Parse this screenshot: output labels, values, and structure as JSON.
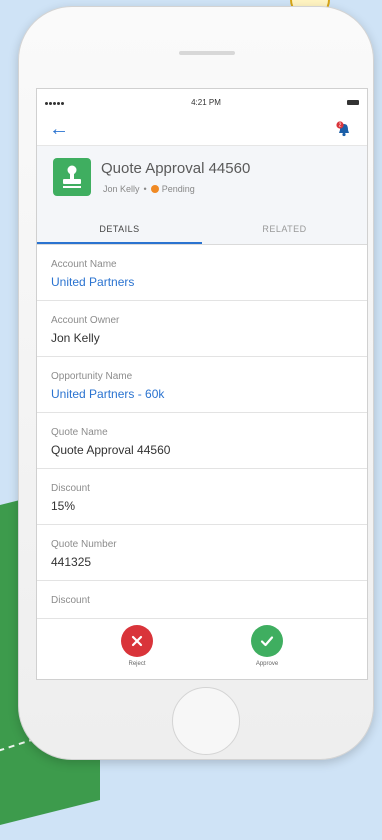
{
  "status_bar": {
    "time": "4:21 PM"
  },
  "record": {
    "title": "Quote Approval 44560",
    "owner": "Jon Kelly",
    "separator": "•",
    "status": "Pending"
  },
  "tabs": [
    {
      "label": "DETAILS",
      "active": true
    },
    {
      "label": "RELATED",
      "active": false
    }
  ],
  "fields": [
    {
      "label": "Account Name",
      "value": "United Partners",
      "link": true
    },
    {
      "label": "Account Owner",
      "value": "Jon Kelly",
      "link": false
    },
    {
      "label": "Opportunity Name",
      "value": "United Partners - 60k",
      "link": true
    },
    {
      "label": "Quote Name",
      "value": "Quote Approval 44560",
      "link": false
    },
    {
      "label": "Discount",
      "value": "15%",
      "link": false
    },
    {
      "label": "Quote Number",
      "value": "441325",
      "link": false
    },
    {
      "label": "Discount",
      "value": "",
      "link": false
    }
  ],
  "notification": {
    "count": "2"
  },
  "actions": {
    "reject_label": "Reject",
    "approve_label": "Approve"
  },
  "icons": {
    "back": "arrow-left-icon",
    "bell": "notification-bell-icon",
    "record": "approval-stamp-icon",
    "reject": "x-icon",
    "approve": "check-icon"
  },
  "colors": {
    "link": "#2a73d0",
    "record_icon": "#3fae60",
    "pending": "#f08a24",
    "reject": "#d9343a",
    "approve": "#3fae60"
  }
}
